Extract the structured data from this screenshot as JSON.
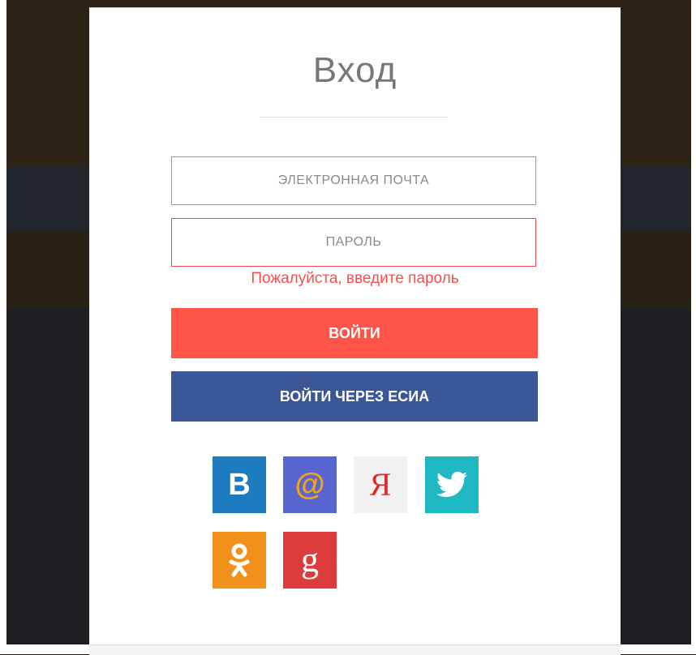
{
  "login": {
    "title": "Вход",
    "email_placeholder": "ЭЛЕКТРОННАЯ ПОЧТА",
    "password_placeholder": "ПАРОЛЬ",
    "password_error": "Пожалуйста, введите пароль",
    "login_button": "ВОЙТИ",
    "esia_button": "ВОЙТИ ЧЕРЕЗ ЕСИА"
  },
  "social": {
    "vk_glyph": "B",
    "mail_glyph": "@",
    "yandex_glyph": "Я",
    "google_glyph": "g",
    "icons": [
      "vk-icon",
      "mailru-icon",
      "yandex-icon",
      "twitter-icon",
      "odnoklassniki-icon",
      "google-plus-icon"
    ],
    "colors": {
      "vk": "#1d7cbf",
      "mailru": "#5866d0",
      "yandex": "#f1f1f1",
      "twitter": "#1fb9c4",
      "odnoklassniki": "#f29119",
      "google_plus": "#de3b3c"
    }
  },
  "colors": {
    "accent_login": "#ff5447",
    "accent_esia": "#3a5696",
    "error": "#ff4b4b"
  }
}
